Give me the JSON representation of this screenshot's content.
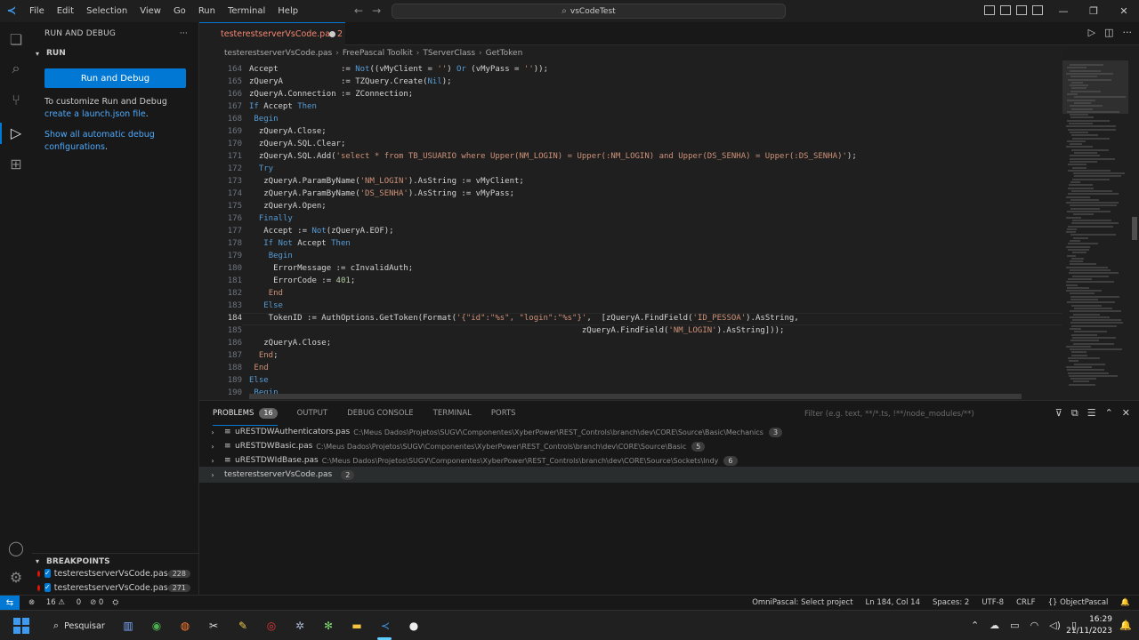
{
  "titlebar": {
    "menu": [
      "File",
      "Edit",
      "Selection",
      "View",
      "Go",
      "Run",
      "Terminal",
      "Help"
    ],
    "search_text": "vsCodeTest"
  },
  "sidebar": {
    "title": "RUN AND DEBUG",
    "section": "RUN",
    "run_button": "Run and Debug",
    "text1": "To customize Run and Debug ",
    "text1_link": "create a launch.json file",
    "text1_end": ".",
    "link2": "Show all automatic debug configurations",
    "link2_end": ".",
    "breakpoints_title": "BREAKPOINTS",
    "breakpoints": [
      {
        "file": "testerestserverVsCode.pas",
        "line": "228"
      },
      {
        "file": "testerestserverVsCode.pas",
        "line": "271"
      }
    ]
  },
  "tab": {
    "label": "testerestserverVsCode.pas 2"
  },
  "breadcrumb": [
    "testerestserverVsCode.pas",
    "FreePascal Toolkit",
    "TServerClass",
    "GetToken"
  ],
  "editor": {
    "line_numbers": [
      "164",
      "165",
      "166",
      "167",
      "168",
      "169",
      "170",
      "171",
      "172",
      "173",
      "174",
      "175",
      "176",
      "177",
      "178",
      "179",
      "180",
      "181",
      "182",
      "183",
      "184",
      "185",
      "186",
      "187",
      "188",
      "189",
      "190"
    ],
    "current_line": "184"
  },
  "panel": {
    "tabs": [
      {
        "label": "PROBLEMS",
        "badge": "16"
      },
      {
        "label": "OUTPUT"
      },
      {
        "label": "DEBUG CONSOLE"
      },
      {
        "label": "TERMINAL"
      },
      {
        "label": "PORTS"
      }
    ],
    "filter_placeholder": "Filter (e.g. text, **/*.ts, !**/node_modules/**)",
    "problems": [
      {
        "file": "uRESTDWAuthenticators.pas",
        "path": "C:\\Meus Dados\\Projetos\\SUGV\\Componentes\\XyberPower\\REST_Controls\\branch\\dev\\CORE\\Source\\Basic\\Mechanics",
        "count": "3"
      },
      {
        "file": "uRESTDWBasic.pas",
        "path": "C:\\Meus Dados\\Projetos\\SUGV\\Componentes\\XyberPower\\REST_Controls\\branch\\dev\\CORE\\Source\\Basic",
        "count": "5"
      },
      {
        "file": "uRESTDWIdBase.pas",
        "path": "C:\\Meus Dados\\Projetos\\SUGV\\Componentes\\XyberPower\\REST_Controls\\branch\\dev\\CORE\\Source\\Sockets\\Indy",
        "count": "6"
      },
      {
        "file": "testerestserverVsCode.pas",
        "path": "",
        "count": "2"
      }
    ]
  },
  "statusbar": {
    "errors": "16",
    "warnings": "0",
    "omnipascal": "OmniPascal: Select project",
    "position": "Ln 184, Col 14",
    "spaces": "Spaces: 2",
    "encoding": "UTF-8",
    "eol": "CRLF",
    "language": "ObjectPascal"
  },
  "taskbar": {
    "search": "Pesquisar",
    "time": "16:29",
    "date": "21/11/2023"
  },
  "colors": {
    "accent": "#0078d4",
    "keyword": "#569cd6",
    "string": "#ce9178",
    "breakpoint": "#e51400"
  }
}
